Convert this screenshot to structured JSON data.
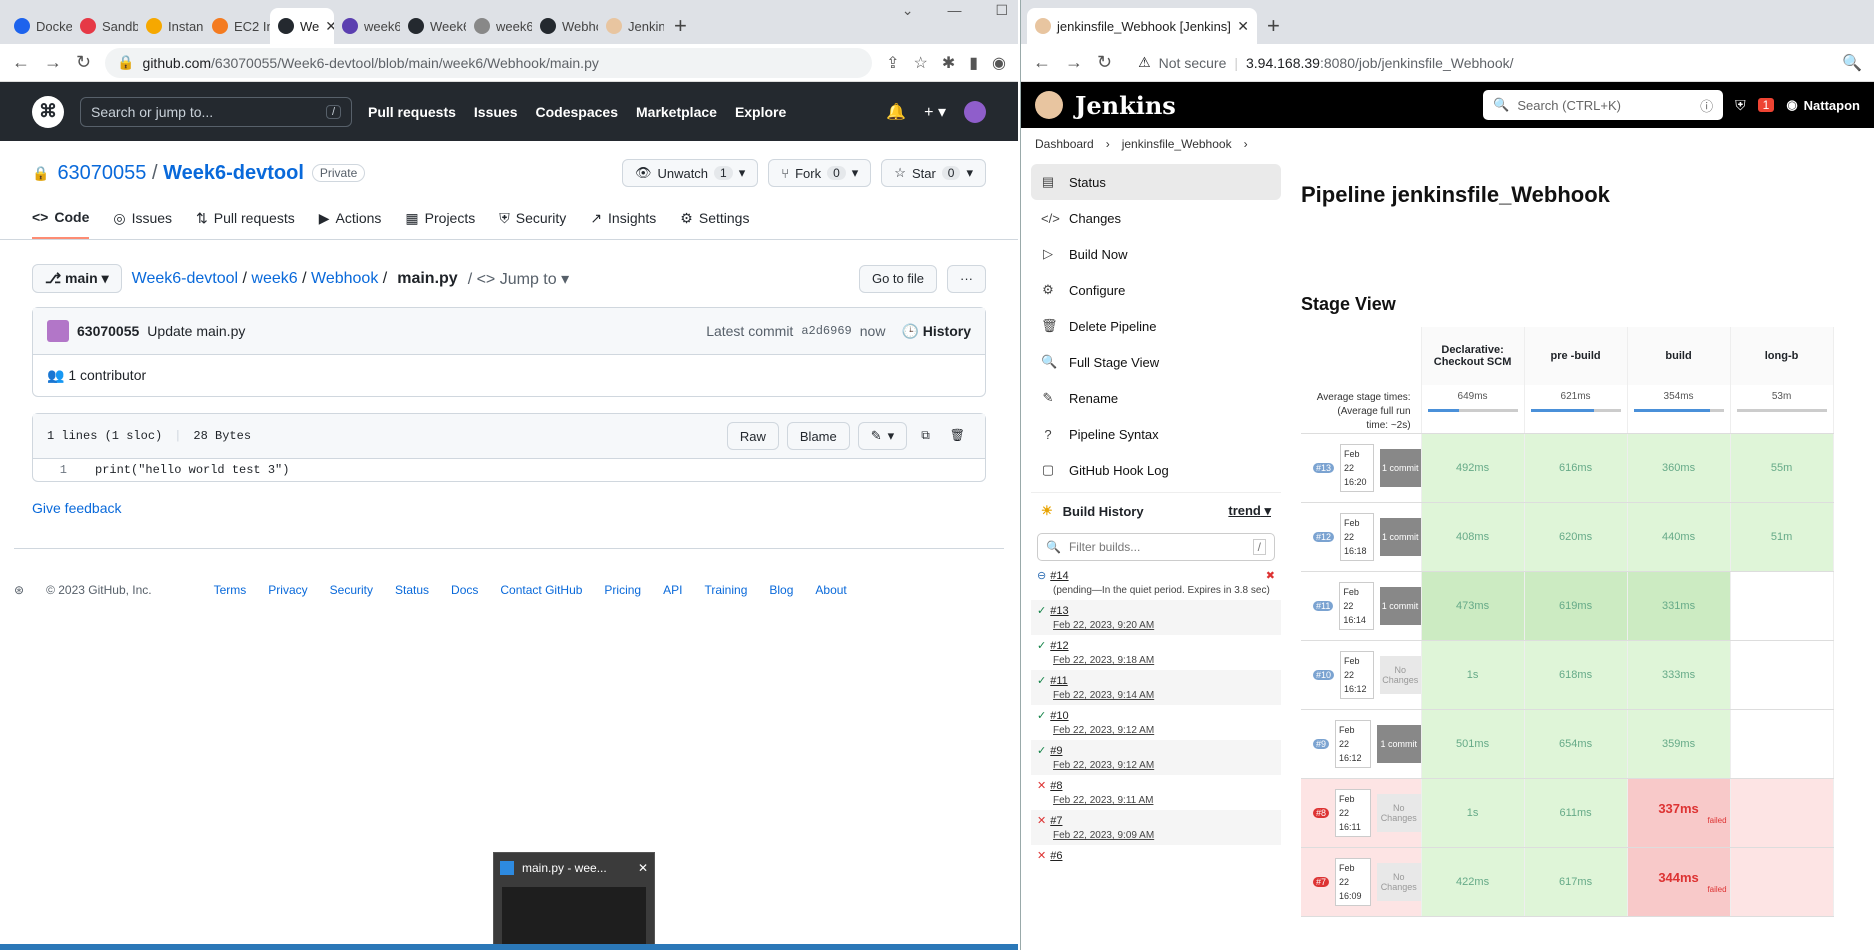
{
  "left_browser": {
    "tabs": [
      "Docke",
      "Sandb",
      "Instan",
      "EC2 In",
      "We",
      "week6",
      "Week6",
      "week6",
      "Webho",
      "Jenkin"
    ],
    "url_host": "github.com",
    "url_path": "/63070055/Week6-devtool/blob/main/week6/Webhook/main.py"
  },
  "github": {
    "search_placeholder": "Search or jump to...",
    "search_key": "/",
    "nav": [
      "Pull requests",
      "Issues",
      "Codespaces",
      "Marketplace",
      "Explore"
    ],
    "owner": "63070055",
    "separator": "/",
    "repo": "Week6-devtool",
    "visibility": "Private",
    "unwatch": "Unwatch",
    "unwatch_count": "1",
    "fork": "Fork",
    "fork_count": "0",
    "star": "Star",
    "star_count": "0",
    "tabs": [
      "Code",
      "Issues",
      "Pull requests",
      "Actions",
      "Projects",
      "Security",
      "Insights",
      "Settings"
    ],
    "branch": "main",
    "crumb": [
      "Week6-devtool",
      "week6",
      "Webhook"
    ],
    "file": "main.py",
    "jump": "Jump to",
    "goto_file": "Go to file",
    "more": "···",
    "commit_user": "63070055",
    "commit_msg": "Update main.py",
    "latest_commit": "Latest commit",
    "commit_sha": "a2d6969",
    "commit_time": "now",
    "history": "History",
    "contributors": "1 contributor",
    "lines": "1 lines (1 sloc)",
    "size": "28 Bytes",
    "raw": "Raw",
    "blame": "Blame",
    "line_no": "1",
    "code": "print(\"hello world test 3\")",
    "feedback": "Give feedback",
    "copyright": "© 2023 GitHub, Inc.",
    "footer_links": [
      "Terms",
      "Privacy",
      "Security",
      "Status",
      "Docs",
      "Contact GitHub",
      "Pricing",
      "API",
      "Training",
      "Blog",
      "About"
    ]
  },
  "thumbnail": {
    "title": "main.py - wee..."
  },
  "right_browser": {
    "tab_title": "jenkinsfile_Webhook [Jenkins]",
    "security": "Not secure",
    "url_host": "3.94.168.39",
    "url_path": ":8080/job/jenkinsfile_Webhook/"
  },
  "jenkins": {
    "logo": "Jenkins",
    "search_placeholder": "Search (CTRL+K)",
    "alerts": "1",
    "user": "Nattapon",
    "breadcrumb": [
      "Dashboard",
      "jenkinsfile_Webhook"
    ],
    "side": [
      "Status",
      "Changes",
      "Build Now",
      "Configure",
      "Delete Pipeline",
      "Full Stage View",
      "Rename",
      "Pipeline Syntax",
      "GitHub Hook Log"
    ],
    "build_history": "Build History",
    "trend": "trend",
    "filter_placeholder": "Filter builds...",
    "filter_key": "/",
    "builds": [
      {
        "num": "#14",
        "date": "(pending—In the quiet period. Expires in 3.8 sec)",
        "status": "pending"
      },
      {
        "num": "#13",
        "date": "Feb 22, 2023, 9:20 AM",
        "status": "ok"
      },
      {
        "num": "#12",
        "date": "Feb 22, 2023, 9:18 AM",
        "status": "ok"
      },
      {
        "num": "#11",
        "date": "Feb 22, 2023, 9:14 AM",
        "status": "ok"
      },
      {
        "num": "#10",
        "date": "Feb 22, 2023, 9:12 AM",
        "status": "ok"
      },
      {
        "num": "#9",
        "date": "Feb 22, 2023, 9:12 AM",
        "status": "ok"
      },
      {
        "num": "#8",
        "date": "Feb 22, 2023, 9:11 AM",
        "status": "fail"
      },
      {
        "num": "#7",
        "date": "Feb 22, 2023, 9:09 AM",
        "status": "fail"
      },
      {
        "num": "#6",
        "date": "",
        "status": "fail"
      }
    ],
    "title": "Pipeline jenkinsfile_Webhook",
    "stage_view": "Stage View",
    "avg_label": "Average stage times:",
    "avg_runtime": "(Average full run time: ~2s)",
    "stages": [
      "Declarative: Checkout SCM",
      "pre -build",
      "build",
      "long-b"
    ],
    "avg_times": [
      "649ms",
      "621ms",
      "354ms",
      "53m"
    ],
    "avg_fill": [
      0.35,
      0.7,
      0.85,
      0
    ],
    "rows": [
      {
        "num": "#13",
        "day": "Feb 22",
        "time": "16:20",
        "changes": "1 commit",
        "has_commit": true,
        "cells": [
          "492ms",
          "616ms",
          "360ms",
          "55m"
        ],
        "failed_idx": -1
      },
      {
        "num": "#12",
        "day": "Feb 22",
        "time": "16:18",
        "changes": "1 commit",
        "has_commit": true,
        "cells": [
          "408ms",
          "620ms",
          "440ms",
          "51m"
        ],
        "failed_idx": -1
      },
      {
        "num": "#11",
        "day": "Feb 22",
        "time": "16:14",
        "changes": "1 commit",
        "has_commit": true,
        "cells": [
          "473ms",
          "619ms",
          "331ms",
          ""
        ],
        "failed_idx": -1
      },
      {
        "num": "#10",
        "day": "Feb 22",
        "time": "16:12",
        "changes": "No Changes",
        "has_commit": false,
        "cells": [
          "1s",
          "618ms",
          "333ms",
          ""
        ],
        "failed_idx": -1
      },
      {
        "num": "#9",
        "day": "Feb 22",
        "time": "16:12",
        "changes": "1 commit",
        "has_commit": true,
        "cells": [
          "501ms",
          "654ms",
          "359ms",
          ""
        ],
        "failed_idx": -1
      },
      {
        "num": "#8",
        "day": "Feb 22",
        "time": "16:11",
        "changes": "No Changes",
        "has_commit": false,
        "cells": [
          "1s",
          "611ms",
          "337ms",
          ""
        ],
        "failed_idx": 2
      },
      {
        "num": "#7",
        "day": "Feb 22",
        "time": "16:09",
        "changes": "No Changes",
        "has_commit": false,
        "cells": [
          "422ms",
          "617ms",
          "344ms",
          ""
        ],
        "failed_idx": 2
      }
    ],
    "failed_label": "failed"
  }
}
